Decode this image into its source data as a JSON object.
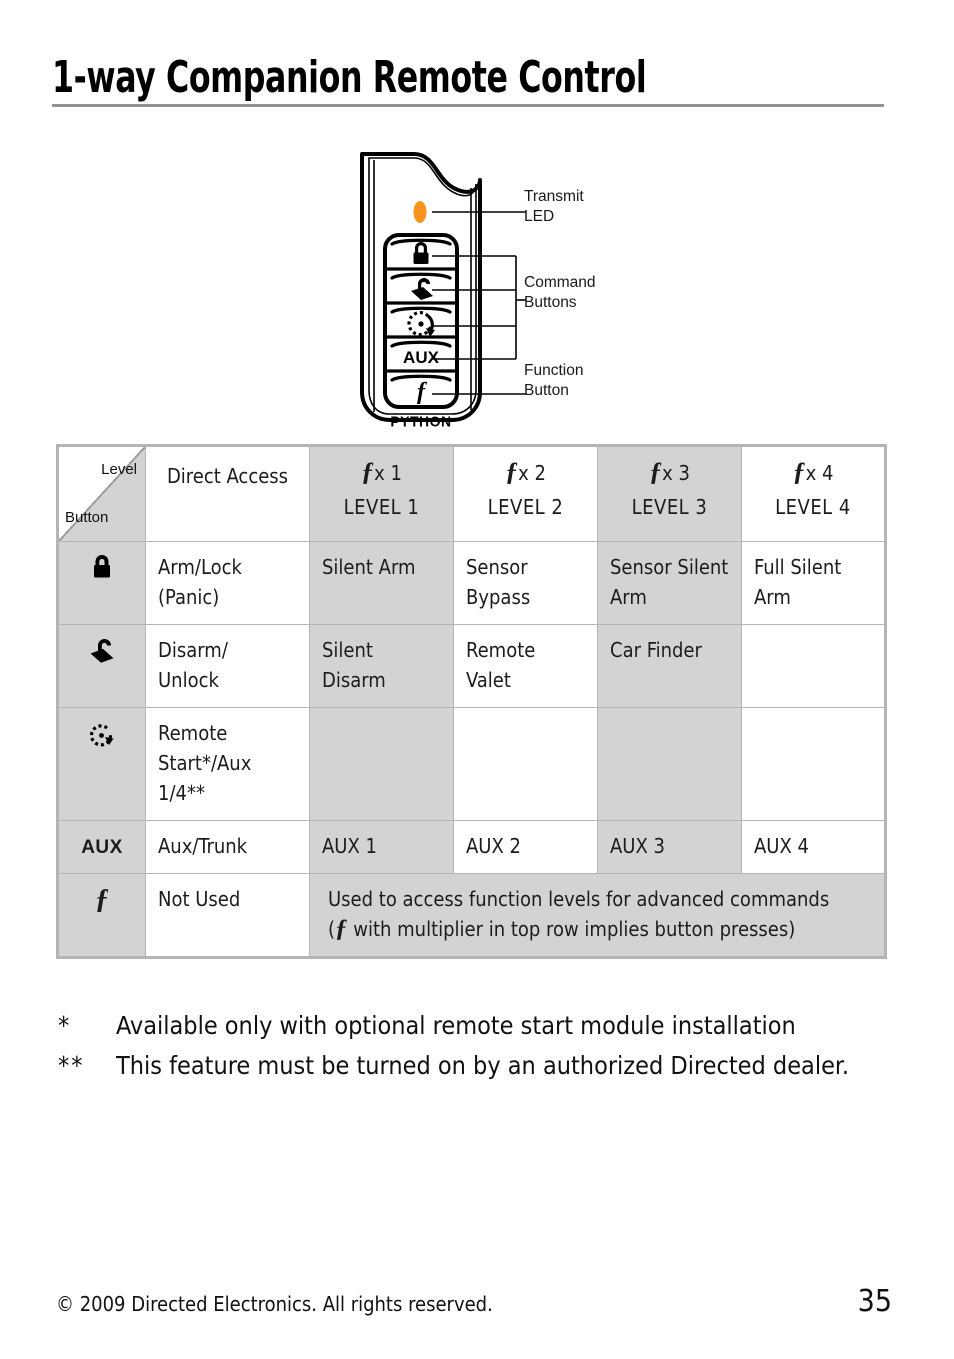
{
  "page": {
    "title": "1-way Companion Remote Control",
    "number": "35",
    "copyright": "© 2009 Directed Electronics. All rights reserved."
  },
  "diagram": {
    "brand_logo": "PYTHON",
    "led_color": "#F7941E",
    "callouts": [
      {
        "id": "transmit-led",
        "label": "Transmit\nLED"
      },
      {
        "id": "command-buttons",
        "label": "Command\nButtons"
      },
      {
        "id": "function-button",
        "label": "Function\nButton"
      }
    ],
    "buttons": [
      {
        "id": "lock-button",
        "icon": "lock-icon",
        "label": ""
      },
      {
        "id": "unlock-button",
        "icon": "unlock-icon",
        "label": ""
      },
      {
        "id": "remote-start-button",
        "icon": "remote-start-icon",
        "label": ""
      },
      {
        "id": "aux-button",
        "icon": "aux-text-icon",
        "label": "AUX"
      },
      {
        "id": "function-button",
        "icon": "function-f-icon",
        "label": "f"
      }
    ]
  },
  "table": {
    "corner": {
      "level_label": "Level",
      "button_label": "Button"
    },
    "headers": {
      "direct_access": "Direct Access",
      "levels": [
        {
          "multiplier": "x 1",
          "level": "LEVEL 1"
        },
        {
          "multiplier": "x 2",
          "level": "LEVEL 2"
        },
        {
          "multiplier": "x 3",
          "level": "LEVEL 3"
        },
        {
          "multiplier": "x 4",
          "level": "LEVEL 4"
        }
      ]
    },
    "rows": [
      {
        "icon": "lock-icon",
        "icon_label": "",
        "direct_access": "Arm/Lock\n(Panic)",
        "level1": "Silent Arm",
        "level2": "Sensor\nBypass",
        "level3": "Sensor Silent\nArm",
        "level4": "Full Silent\nArm"
      },
      {
        "icon": "unlock-icon",
        "icon_label": "",
        "direct_access": "Disarm/\nUnlock",
        "level1": "Silent Disarm",
        "level2": "Remote Valet",
        "level3": "Car Finder",
        "level4": ""
      },
      {
        "icon": "remote-start-icon",
        "icon_label": "",
        "direct_access": "Remote\nStart*/Aux\n1/4**",
        "level1": "",
        "level2": "",
        "level3": "",
        "level4": ""
      },
      {
        "icon": "aux-text-icon",
        "icon_label": "AUX",
        "direct_access": "Aux/Trunk",
        "level1": "AUX 1",
        "level2": "AUX 2",
        "level3": "AUX 3",
        "level4": "AUX 4"
      }
    ],
    "function_row": {
      "icon": "function-f-icon",
      "icon_label": "f",
      "direct_access": "Not Used",
      "note_line1": "Used to access function levels for advanced commands",
      "note_line2_before": "(",
      "note_line2_f": "f",
      "note_line2_after": " with multiplier in top row implies button presses)"
    }
  },
  "footnotes": [
    {
      "mark": "*",
      "text": "Available only with optional remote start module installation"
    },
    {
      "mark": "**",
      "text": "This feature must be turned on by an authorized Directed dealer."
    }
  ],
  "colors": {
    "shade": "#d3d3d3",
    "border": "#b4b4b4",
    "rule": "#929292",
    "led": "#F7941E"
  }
}
